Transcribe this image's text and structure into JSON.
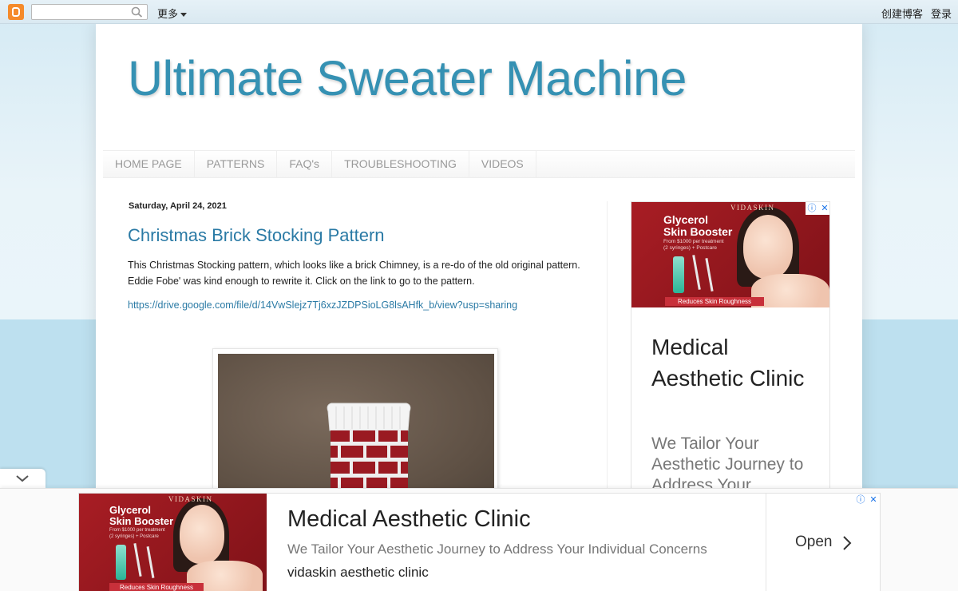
{
  "navbar": {
    "search_placeholder": "",
    "more_label": "更多",
    "create_blog": "创建博客",
    "sign_in": "登录"
  },
  "blog": {
    "title": "Ultimate Sweater Machine",
    "tabs": [
      "HOME PAGE",
      "PATTERNS",
      "FAQ's",
      "TROUBLESHOOTING",
      "VIDEOS"
    ]
  },
  "post": {
    "date": "Saturday, April 24, 2021",
    "title": "Christmas Brick Stocking Pattern",
    "body": " This Christmas Stocking pattern, which looks like a brick Chimney, is a re-do of the old original pattern. Eddie Fobe' was kind enough to rewrite it.  Click on the link to go to the pattern.",
    "link": "https://drive.google.com/file/d/14VwSlejz7Tj6xzJZDPSioLG8lsAHfk_b/view?usp=sharing"
  },
  "ad": {
    "brand": "VIDASKIN",
    "image_headline_1": "Glycerol",
    "image_headline_2": "Skin Booster",
    "image_sub_1": "From $1000 per treatment",
    "image_sub_2": "(2 syringes) + Postcare",
    "image_strip": "Reduces Skin Roughness",
    "headline": "Medical Aesthetic Clinic",
    "description_full": "We Tailor Your Aesthetic Journey to Address Your Individual Concerns",
    "description_cropped": "We Tailor Your Aesthetic Journey to Address Your",
    "advertiser": "vidaskin aesthetic clinic",
    "cta": "Open",
    "adchoices_icon": "info-icon",
    "close_icon": "close-icon"
  },
  "colors": {
    "title_blue": "#3591b3",
    "link_blue": "#2a7aa5",
    "ad_red": "#a81d24"
  }
}
